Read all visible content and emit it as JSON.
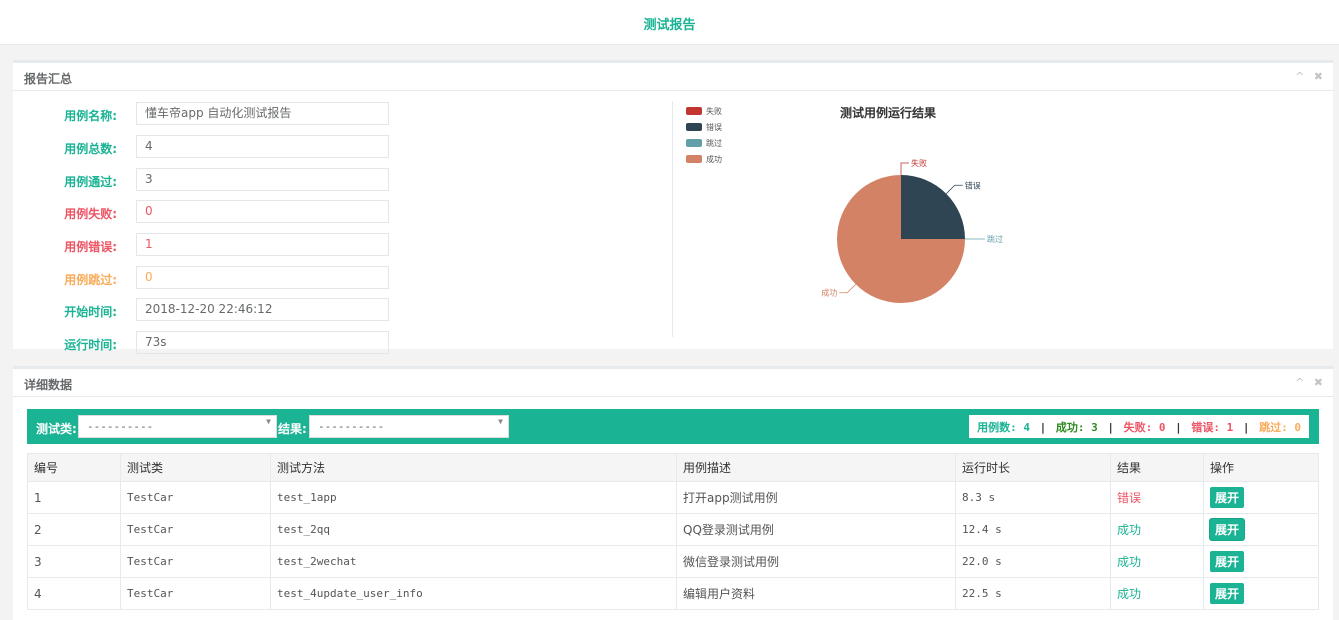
{
  "header": {
    "title": "测试报告"
  },
  "summary_panel": {
    "title": "报告汇总",
    "tools": {
      "collapse": "^",
      "close": "✖"
    },
    "fields": [
      {
        "label": "用例名称:",
        "value": "懂车帝app 自动化测试报告"
      },
      {
        "label": "用例总数:",
        "value": "4"
      },
      {
        "label": "用例通过:",
        "value": "3"
      },
      {
        "label": "用例失败:",
        "value": "0"
      },
      {
        "label": "用例错误:",
        "value": "1"
      },
      {
        "label": "用例跳过:",
        "value": "0"
      },
      {
        "label": "开始时间:",
        "value": "2018-12-20 22:46:12"
      },
      {
        "label": "运行时间:",
        "value": "73s"
      }
    ],
    "colors": {
      "green": "#1ab394",
      "red": "#ed5565",
      "orange": "#f8ac59"
    }
  },
  "chart_data": {
    "type": "pie",
    "title": "测试用例运行结果",
    "legend_position": "top-left",
    "series": [
      {
        "name": "失败",
        "value": 0,
        "color": "#c23531"
      },
      {
        "name": "错误",
        "value": 1,
        "color": "#2f4554"
      },
      {
        "name": "跳过",
        "value": 0,
        "color": "#61a0a8"
      },
      {
        "name": "成功",
        "value": 3,
        "color": "#d48265"
      }
    ]
  },
  "details_panel": {
    "title": "详细数据",
    "filters": {
      "class_label": "测试类:",
      "class_value": "----------",
      "result_label": "结果:",
      "result_value": "----------"
    },
    "stats": {
      "total": "用例数: 4",
      "success": "成功: 3",
      "fail": "失败: 0",
      "error": "错误: 1",
      "skip": "跳过: 0",
      "sep": "|"
    },
    "table": {
      "headers": [
        "编号",
        "测试类",
        "测试方法",
        "用例描述",
        "运行时长",
        "结果",
        "操作"
      ],
      "rows": [
        {
          "id": "1",
          "cls": "TestCar",
          "method": "test_1app",
          "desc": "打开app测试用例",
          "time": "8.3 s",
          "result": "错误",
          "action": "展开"
        },
        {
          "id": "2",
          "cls": "TestCar",
          "method": "test_2qq",
          "desc": "QQ登录测试用例",
          "time": "12.4 s",
          "result": "成功",
          "action": "展开"
        },
        {
          "id": "3",
          "cls": "TestCar",
          "method": "test_2wechat",
          "desc": "微信登录测试用例",
          "time": "22.0 s",
          "result": "成功",
          "action": "展开"
        },
        {
          "id": "4",
          "cls": "TestCar",
          "method": "test_4update_user_info",
          "desc": "编辑用户资料",
          "time": "22.5 s",
          "result": "成功",
          "action": "展开"
        }
      ]
    }
  }
}
